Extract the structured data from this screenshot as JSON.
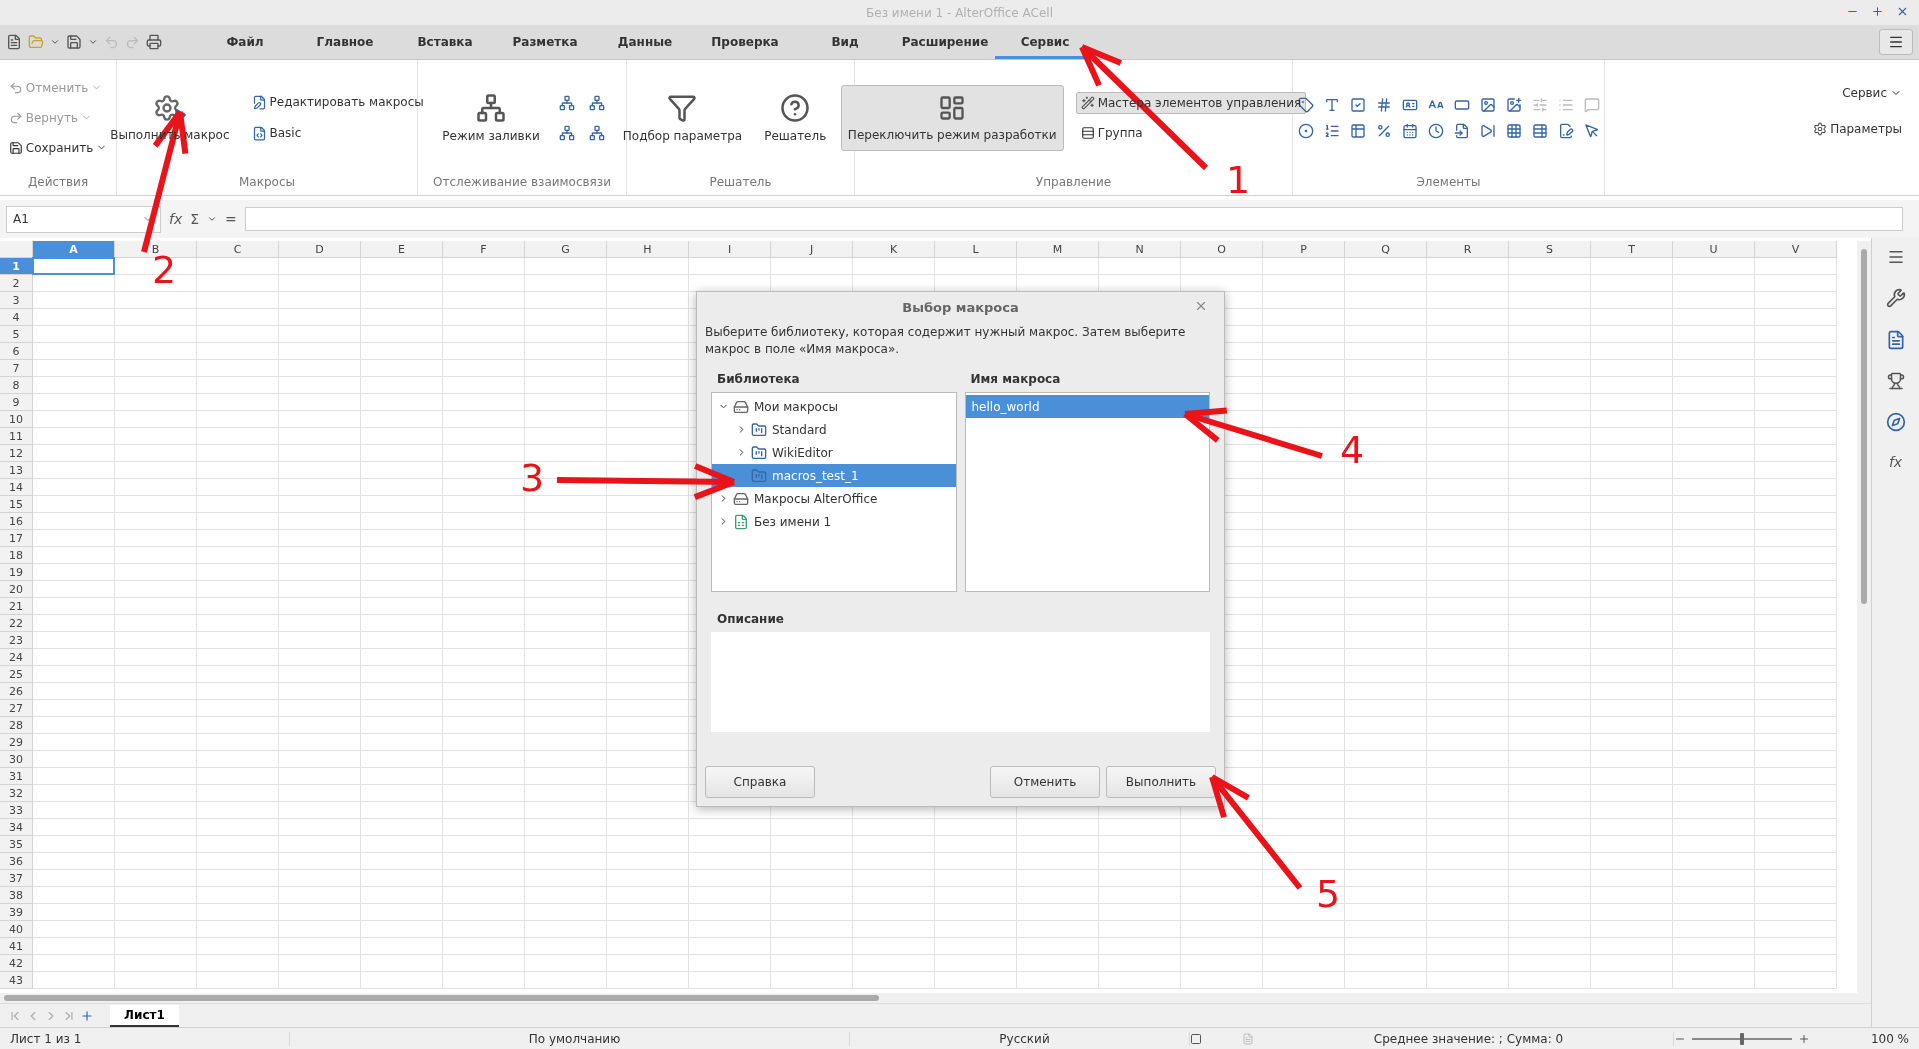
{
  "window": {
    "title": "Без имени 1 - AlterOffice ACell"
  },
  "menu_tabs": [
    {
      "label": "Файл",
      "selected": false
    },
    {
      "label": "Главное",
      "selected": false
    },
    {
      "label": "Вставка",
      "selected": false
    },
    {
      "label": "Разметка",
      "selected": false
    },
    {
      "label": "Данные",
      "selected": false
    },
    {
      "label": "Проверка",
      "selected": false
    },
    {
      "label": "Вид",
      "selected": false
    },
    {
      "label": "Расширение",
      "selected": false
    },
    {
      "label": "Сервис",
      "selected": true
    }
  ],
  "ribbon": {
    "groups": [
      {
        "kind": "actions",
        "label": "Действия",
        "items": [
          {
            "label": "Отменить",
            "disabled": true
          },
          {
            "label": "Вернуть",
            "disabled": true
          },
          {
            "label": "Сохранить",
            "disabled": false
          }
        ]
      },
      {
        "kind": "macros",
        "label": "Макросы",
        "items": [
          {
            "label": "Выполнить макрос"
          },
          {
            "label": "Редактировать макросы"
          },
          {
            "label": "Basic"
          }
        ]
      },
      {
        "kind": "trace",
        "label": "Отслеживание взаимосвязи",
        "items": [
          {
            "label": "Режим заливки"
          }
        ]
      },
      {
        "kind": "solver",
        "label": "Решатель",
        "items": [
          {
            "label": "Подбор параметра"
          },
          {
            "label": "Решатель"
          }
        ]
      },
      {
        "kind": "controls",
        "label": "Управление",
        "items": [
          {
            "label": "Переключить режим разработки",
            "pressed": true
          },
          {
            "label": "Мастера элементов управления",
            "pressed": true
          },
          {
            "label": "Группа",
            "pressed": false
          }
        ]
      },
      {
        "kind": "elements",
        "label": "Элементы",
        "items": [
          {
            "disabled": false
          },
          {
            "disabled": false
          },
          {
            "disabled": false
          },
          {
            "disabled": false
          },
          {
            "disabled": false
          },
          {
            "disabled": false
          },
          {
            "disabled": false
          },
          {
            "disabled": false
          },
          {
            "disabled": false
          },
          {
            "disabled": true
          },
          {
            "disabled": true
          },
          {
            "disabled": true
          },
          {
            "disabled": false
          },
          {
            "disabled": false
          },
          {
            "disabled": false
          },
          {
            "disabled": false
          },
          {
            "disabled": false
          },
          {
            "disabled": false
          },
          {
            "disabled": false
          },
          {
            "disabled": false
          },
          {
            "disabled": false
          },
          {
            "disabled": false
          },
          {
            "disabled": false
          },
          {
            "disabled": false
          }
        ]
      }
    ],
    "service_dropdown": "Сервис",
    "options_button": "Параметры"
  },
  "formula_bar": {
    "cell_reference": "A1",
    "function_wizard": "fx",
    "sum": "Σ",
    "equals": "="
  },
  "sheet": {
    "columns": [
      {
        "label": "A",
        "selected": true
      },
      {
        "label": "B",
        "selected": false
      },
      {
        "label": "C",
        "selected": false
      },
      {
        "label": "D",
        "selected": false
      },
      {
        "label": "E",
        "selected": false
      },
      {
        "label": "F",
        "selected": false
      },
      {
        "label": "G",
        "selected": false
      },
      {
        "label": "H",
        "selected": false
      },
      {
        "label": "I",
        "selected": false
      },
      {
        "label": "J",
        "selected": false
      },
      {
        "label": "K",
        "selected": false
      },
      {
        "label": "L",
        "selected": false
      },
      {
        "label": "M",
        "selected": false
      },
      {
        "label": "N",
        "selected": false
      },
      {
        "label": "O",
        "selected": false
      },
      {
        "label": "P",
        "selected": false
      },
      {
        "label": "Q",
        "selected": false
      },
      {
        "label": "R",
        "selected": false
      },
      {
        "label": "S",
        "selected": false
      },
      {
        "label": "T",
        "selected": false
      },
      {
        "label": "U",
        "selected": false
      },
      {
        "label": "V",
        "selected": false
      }
    ],
    "rows": [
      {
        "label": "1",
        "selected": true
      },
      {
        "label": "2",
        "selected": false
      },
      {
        "label": "3",
        "selected": false
      },
      {
        "label": "4",
        "selected": false
      },
      {
        "label": "5",
        "selected": false
      },
      {
        "label": "6",
        "selected": false
      },
      {
        "label": "7",
        "selected": false
      },
      {
        "label": "8",
        "selected": false
      },
      {
        "label": "9",
        "selected": false
      },
      {
        "label": "10",
        "selected": false
      },
      {
        "label": "11",
        "selected": false
      },
      {
        "label": "12",
        "selected": false
      },
      {
        "label": "13",
        "selected": false
      },
      {
        "label": "14",
        "selected": false
      },
      {
        "label": "15",
        "selected": false
      },
      {
        "label": "16",
        "selected": false
      },
      {
        "label": "17",
        "selected": false
      },
      {
        "label": "18",
        "selected": false
      },
      {
        "label": "19",
        "selected": false
      },
      {
        "label": "20",
        "selected": false
      },
      {
        "label": "21",
        "selected": false
      },
      {
        "label": "22",
        "selected": false
      },
      {
        "label": "23",
        "selected": false
      },
      {
        "label": "24",
        "selected": false
      },
      {
        "label": "25",
        "selected": false
      },
      {
        "label": "26",
        "selected": false
      },
      {
        "label": "27",
        "selected": false
      },
      {
        "label": "28",
        "selected": false
      },
      {
        "label": "29",
        "selected": false
      },
      {
        "label": "30",
        "selected": false
      },
      {
        "label": "31",
        "selected": false
      },
      {
        "label": "32",
        "selected": false
      },
      {
        "label": "33",
        "selected": false
      },
      {
        "label": "34",
        "selected": false
      },
      {
        "label": "35",
        "selected": false
      },
      {
        "label": "36",
        "selected": false
      },
      {
        "label": "37",
        "selected": false
      },
      {
        "label": "38",
        "selected": false
      },
      {
        "label": "39",
        "selected": false
      },
      {
        "label": "40",
        "selected": false
      },
      {
        "label": "41",
        "selected": false
      },
      {
        "label": "42",
        "selected": false
      },
      {
        "label": "43",
        "selected": false
      }
    ]
  },
  "sidebar": {
    "function_label": "fx"
  },
  "dialog": {
    "title": "Выбор макроса",
    "instructions": "Выберите библиотеку, которая содержит нужный макрос. Затем выберите макрос в поле «Имя макроса».",
    "library_label": "Библиотека",
    "library_tree": [
      {
        "label": "Мои макросы",
        "kind": "container",
        "expandable": true,
        "expanded": true,
        "selected": false,
        "children": [
          {
            "label": "Standard",
            "kind": "library",
            "expandable": true,
            "expanded": false,
            "selected": false
          },
          {
            "label": "WikiEditor",
            "kind": "library",
            "expandable": true,
            "expanded": false,
            "selected": false
          },
          {
            "label": "macros_test_1",
            "kind": "library",
            "expandable": false,
            "expanded": false,
            "selected": true
          }
        ]
      },
      {
        "label": "Макросы AlterOffice",
        "kind": "container",
        "expandable": true,
        "expanded": false,
        "selected": false
      },
      {
        "label": "Без имени 1",
        "kind": "document",
        "expandable": true,
        "expanded": false,
        "selected": false
      }
    ],
    "macro_name_label": "Имя макроса",
    "macros": [
      {
        "label": "hello_world",
        "selected": true
      }
    ],
    "description_label": "Описание",
    "buttons": {
      "help": "Справка",
      "cancel": "Отменить",
      "run": "Выполнить"
    }
  },
  "sheet_tabs": [
    {
      "label": "Лист1",
      "selected": true
    }
  ],
  "status_bar": {
    "sheet": "Лист 1 из 1",
    "page_style": "По умолчанию",
    "language": "Русский",
    "summary": "Среднее значение: ; Сумма: 0",
    "zoom": {
      "level": 0.5,
      "reading": "100 %"
    }
  },
  "annotations": [
    {
      "number": "1"
    },
    {
      "number": "2"
    },
    {
      "number": "3"
    },
    {
      "number": "4"
    },
    {
      "number": "5"
    }
  ]
}
